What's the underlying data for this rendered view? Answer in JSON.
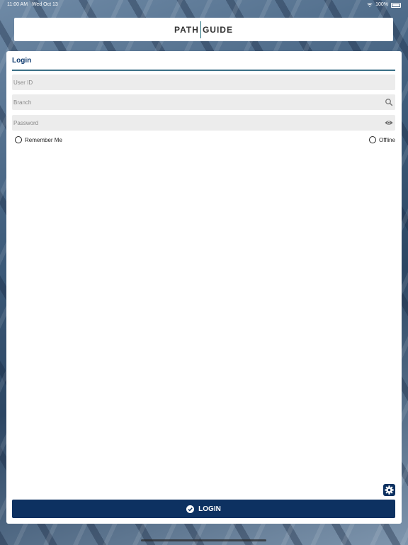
{
  "status_bar": {
    "time": "11:00 AM",
    "date": "Wed Oct 13",
    "battery": "100%"
  },
  "logo": {
    "left": "PATH",
    "right": "GUIDE"
  },
  "login": {
    "title": "Login",
    "user_placeholder": "User ID",
    "branch_placeholder": "Branch",
    "password_placeholder": "Password",
    "remember_label": "Remember Me",
    "offline_label": "Offline",
    "button_label": "LOGIN"
  },
  "icons": {
    "search": "search-icon",
    "eye": "eye-icon",
    "gear": "gear-icon",
    "check": "check-circle-icon"
  },
  "colors": {
    "primary": "#0d3161",
    "accent_rule": "#3a6f86",
    "title": "#0e3a6e"
  }
}
